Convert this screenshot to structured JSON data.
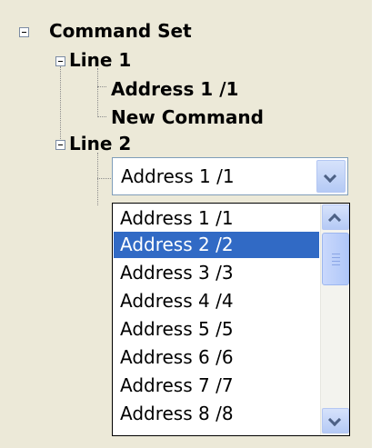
{
  "tree": {
    "root": {
      "label": "Command Set"
    },
    "line1": {
      "label": "Line 1",
      "children": [
        "Address 1 /1",
        "New Command"
      ]
    },
    "line2": {
      "label": "Line 2"
    }
  },
  "combo": {
    "value": "Address 1 /1",
    "options": [
      "Address 1 /1",
      "Address 2 /2",
      "Address 3 /3",
      "Address 4 /4",
      "Address 5 /5",
      "Address 6 /6",
      "Address 7 /7",
      "Address 8 /8"
    ],
    "highlighted": "Address 2 /2"
  },
  "icons": {
    "expander": "minus-box-icon",
    "dropdown_arrow": "chevron-down-icon",
    "scroll_up": "chevron-up-icon",
    "scroll_down": "chevron-down-icon"
  },
  "colors": {
    "background": "#ece9d8",
    "selection": "#316ac5",
    "border": "#7f9db9"
  }
}
